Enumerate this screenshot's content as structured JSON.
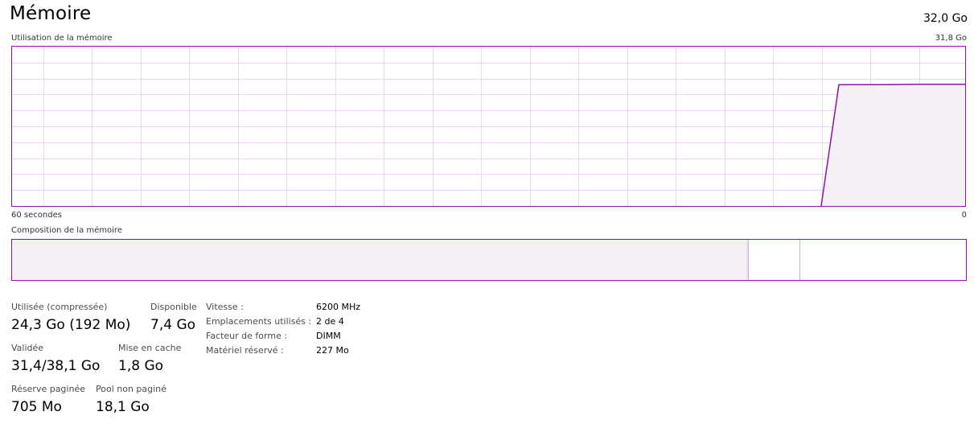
{
  "header": {
    "title": "Mémoire",
    "total": "32,0 Go"
  },
  "usage_graph": {
    "label": "Utilisation de la mémoire",
    "max_label": "31,8 Go",
    "left_time_label": "60 secondes",
    "right_time_label": "0",
    "accent_color": "#8b12ae",
    "fill_color": "#f4f0f6",
    "grid_color": "#ead6f0",
    "scale_max_gb": 31.8,
    "usage_series_gb": [
      0,
      24.2,
      24.2,
      24.3,
      24.3,
      24.3
    ]
  },
  "composition": {
    "label": "Composition de la mémoire"
  },
  "stats": {
    "used_label": "Utilisée (compressée)",
    "used_value": "24,3 Go (192 Mo)",
    "available_label": "Disponible",
    "available_value": "7,4 Go",
    "committed_label": "Validée",
    "committed_value": "31,4/38,1 Go",
    "cached_label": "Mise en cache",
    "cached_value": "1,8 Go",
    "paged_label": "Réserve paginée",
    "paged_value": "705 Mo",
    "nonpaged_label": "Pool non paginé",
    "nonpaged_value": "18,1 Go"
  },
  "properties": {
    "speed_label": "Vitesse :",
    "speed_value": "6200 MHz",
    "slots_label": "Emplacements utilisés :",
    "slots_value": "2 de 4",
    "form_label": "Facteur de forme :",
    "form_value": "DIMM",
    "reserved_label": "Matériel réservé :",
    "reserved_value": "227 Mo"
  }
}
